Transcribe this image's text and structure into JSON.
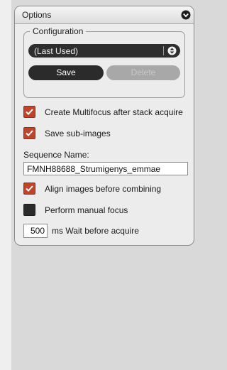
{
  "panel": {
    "title": "Options",
    "collapse_icon": "chevron-down-circle-icon"
  },
  "configuration": {
    "legend": "Configuration",
    "selected": "(Last Used)",
    "save_label": "Save",
    "delete_label": "Delete"
  },
  "options": {
    "create_multifocus": {
      "label": "Create Multifocus after stack acquire",
      "checked": true
    },
    "save_sub_images": {
      "label": "Save sub-images",
      "checked": true
    },
    "align_images": {
      "label": "Align images before combining",
      "checked": true
    },
    "manual_focus": {
      "label": "Perform manual focus",
      "checked": false
    }
  },
  "sequence": {
    "label": "Sequence Name:",
    "value": "FMNH88688_Strumigenys_emmae"
  },
  "wait": {
    "value": "500",
    "label": "ms Wait before acquire"
  },
  "colors": {
    "checkbox_checked": "#c0442a",
    "button_dark": "#2b2b2b"
  }
}
